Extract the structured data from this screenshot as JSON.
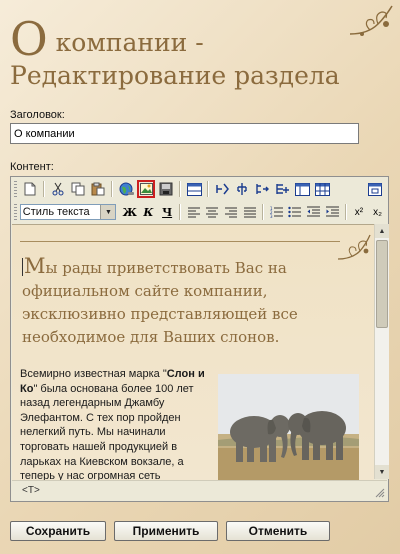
{
  "page": {
    "title_first_letter": "О",
    "title_rest": " компании - Редактирование раздела"
  },
  "form": {
    "title_label": "Заголовок:",
    "title_value": "О компании",
    "content_label": "Контент:"
  },
  "editor": {
    "style_select_value": "Стиль текста",
    "toolbar_icons_row1": [
      "new-document-icon",
      "cut-icon",
      "copy-icon",
      "paste-icon",
      "link-globe-icon",
      "insert-image-icon",
      "insert-media-icon",
      "table-icon",
      "bold-struct-icon",
      "tree-icon",
      "indent-tree-icon",
      "grid-plus-icon",
      "form-icon",
      "table-grid-icon",
      "maximize-icon"
    ],
    "toolbar_row2": {
      "bold": "Ж",
      "italic": "К",
      "underline": "Ч",
      "superscript": "x²",
      "subscript": "x₂"
    },
    "content": {
      "heading_first_letter": "М",
      "heading_rest": "ы рады приветствовать Вас на официальном сайте компании, эксклюзивно представляющей все необходимое для Ваших слонов.",
      "body_before_bold": "Всемирно известная марка \"",
      "body_bold": "Слон и Ко",
      "body_after_bold": "\" была основана более 100 лет назад легендарным Джамбу Элефантом. С тех пор пройден нелегкий путь. Мы начинали торговать нашей продукцией в ларьках на Киевском вокзале, а теперь у нас огромная сеть"
    },
    "status_tag": "<T>"
  },
  "actions": {
    "save_label": "Сохранить",
    "apply_label": "Применить",
    "cancel_label": "Отменить"
  },
  "colors": {
    "heading_brown": "#8b6b3e",
    "page_background": "#f1e4c9",
    "highlight_red": "#cc1f1f"
  }
}
